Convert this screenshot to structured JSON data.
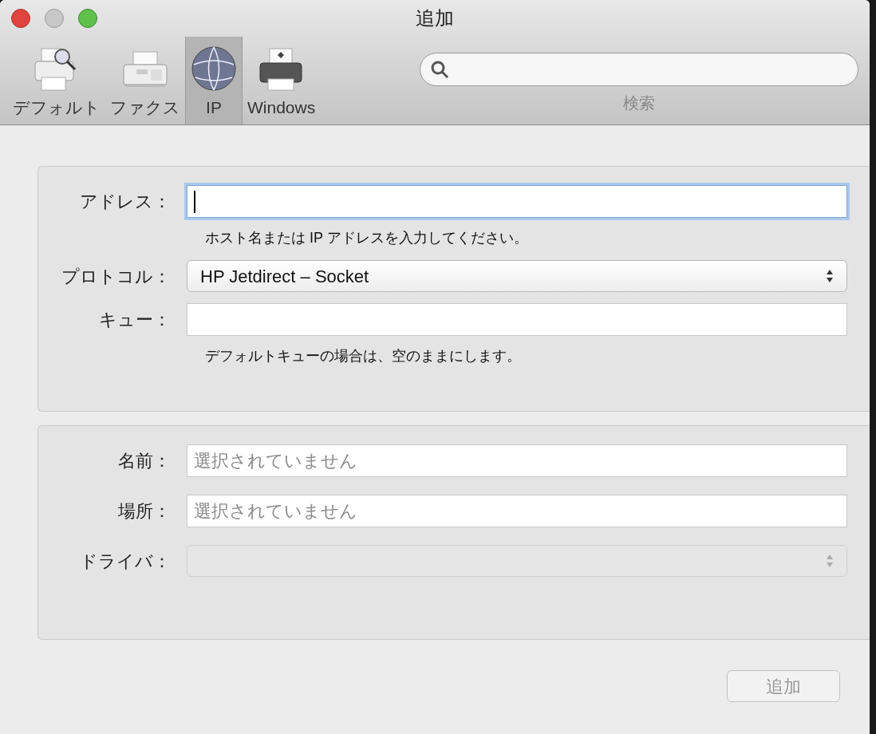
{
  "window": {
    "title": "追加"
  },
  "toolbar": {
    "items": [
      {
        "label": "デフォルト",
        "kind": "printer-search",
        "selected": false
      },
      {
        "label": "ファクス",
        "kind": "fax",
        "selected": false
      },
      {
        "label": "IP",
        "kind": "globe",
        "selected": true
      },
      {
        "label": "Windows",
        "kind": "windows-printer",
        "selected": false
      }
    ]
  },
  "search": {
    "label": "検索"
  },
  "sections": [
    {
      "fields": [
        {
          "label": "アドレス：",
          "kind": "text",
          "focused": true,
          "hint": "ホスト名または IP アドレスを入力してください。"
        },
        {
          "label": "プロトコル：",
          "kind": "popup",
          "value": "HP Jetdirect – Socket",
          "disabled": false
        },
        {
          "label": "キュー：",
          "kind": "text",
          "focused": false,
          "hint": "デフォルトキューの場合は、空のままにします。"
        }
      ]
    },
    {
      "fields": [
        {
          "label": "名前：",
          "kind": "text",
          "focused": false,
          "placeholder": "選択されていません"
        },
        {
          "label": "場所：",
          "kind": "text",
          "focused": false,
          "placeholder": "選択されていません"
        },
        {
          "label": "ドライバ：",
          "kind": "popup",
          "disabled": true
        }
      ]
    }
  ],
  "button": {
    "label": "追加",
    "disabled": true
  }
}
